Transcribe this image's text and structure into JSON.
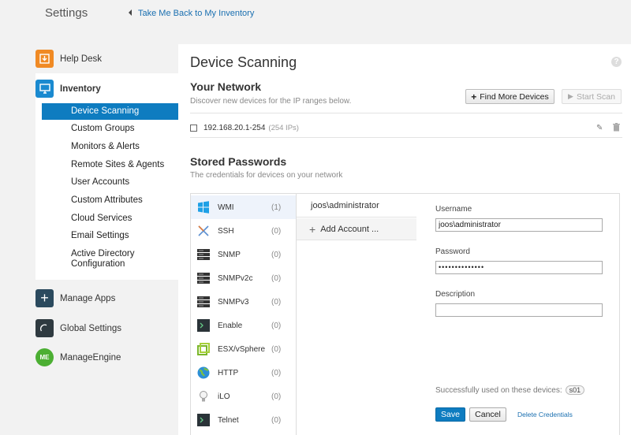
{
  "header": {
    "app_title": "Settings",
    "back_link": "Take Me Back to My Inventory"
  },
  "sidebar": {
    "sections": {
      "help_desk": "Help Desk",
      "inventory": "Inventory",
      "manage_apps": "Manage Apps",
      "global_settings": "Global Settings",
      "manageengine": "ManageEngine"
    },
    "inventory_items": [
      {
        "label": "Device Scanning",
        "active": true
      },
      {
        "label": "Custom Groups"
      },
      {
        "label": "Monitors & Alerts"
      },
      {
        "label": "Remote Sites & Agents"
      },
      {
        "label": "User Accounts"
      },
      {
        "label": "Custom Attributes"
      },
      {
        "label": "Cloud Services"
      },
      {
        "label": "Email Settings"
      },
      {
        "label": "Active Directory Configuration"
      }
    ]
  },
  "main": {
    "title": "Device Scanning",
    "network": {
      "heading": "Your Network",
      "subtitle": "Discover new devices for the IP ranges below.",
      "find_button": "Find More Devices",
      "scan_button": "Start Scan",
      "ip_range": "192.168.20.1-254",
      "ip_count": "(254 IPs)"
    },
    "passwords": {
      "heading": "Stored Passwords",
      "subtitle": "The credentials for devices on your network",
      "types": [
        {
          "name": "WMI",
          "count": "(1)",
          "icon": "windows-icon",
          "active": true
        },
        {
          "name": "SSH",
          "count": "(0)",
          "icon": "ssh-icon"
        },
        {
          "name": "SNMP",
          "count": "(0)",
          "icon": "server-icon"
        },
        {
          "name": "SNMPv2c",
          "count": "(0)",
          "icon": "server-icon"
        },
        {
          "name": "SNMPv3",
          "count": "(0)",
          "icon": "server-icon"
        },
        {
          "name": "Enable",
          "count": "(0)",
          "icon": "terminal-icon"
        },
        {
          "name": "ESX/vSphere",
          "count": "(0)",
          "icon": "vsphere-icon"
        },
        {
          "name": "HTTP",
          "count": "(0)",
          "icon": "globe-icon"
        },
        {
          "name": "iLO",
          "count": "(0)",
          "icon": "bulb-icon"
        },
        {
          "name": "Telnet",
          "count": "(0)",
          "icon": "terminal-icon"
        }
      ],
      "selected_account": "joos\\administrator",
      "add_account": "Add Account ...",
      "form": {
        "username_label": "Username",
        "username_value": "joos\\administrator",
        "password_label": "Password",
        "password_value": "••••••••••••••",
        "description_label": "Description",
        "description_value": "",
        "used_on_label": "Successfully used on these devices:",
        "used_on_device": "s01",
        "save": "Save",
        "cancel": "Cancel",
        "delete": "Delete Credentials"
      }
    }
  },
  "colors": {
    "accent": "#0e7cc0",
    "help_desk": "#f08a24",
    "inventory": "#1a8ad0",
    "manage_apps": "#2b4a5e",
    "global_settings": "#2f3a40",
    "manageengine": "#4caf33"
  }
}
